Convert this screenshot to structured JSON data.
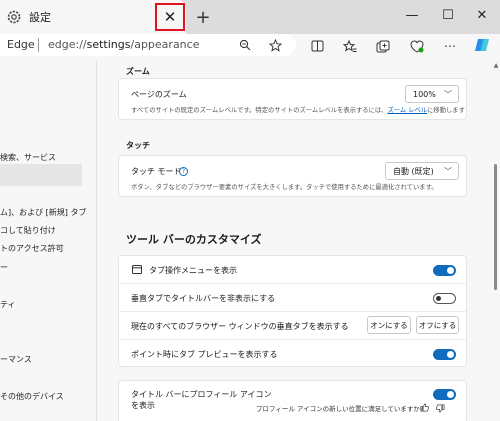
{
  "window": {
    "tab_title": "設定",
    "close_tab_symbol": "✕",
    "new_tab_symbol": "+",
    "minimize_symbol": "—",
    "maximize_symbol": "☐",
    "close_symbol": "✕"
  },
  "address_bar": {
    "site_label": "Edge",
    "url_prefix": "edge://",
    "url_bold": "settings",
    "url_suffix": "/appearance"
  },
  "sidebar": {
    "items": [
      "検索、サービス",
      "",
      "ム]、および [新規] タブ",
      "コして貼り付け",
      "トのアクセス許可",
      "ー",
      "ティ",
      "ーマンス",
      "その他のデバイス"
    ]
  },
  "zoom": {
    "section_title": "ズーム",
    "label": "ページのズーム",
    "description_prefix": "すべてのサイトの既定のズームレベルです。特定のサイトのズームレベルを表示するには、",
    "description_link": "ズーム レベル",
    "description_suffix": "に移動します",
    "value": "100%"
  },
  "touch": {
    "section_title": "タッチ",
    "label": "タッチ モード",
    "description": "ボタン、タブなどのブラウザー要素のサイズを大きくします。タッチで使用するために最適化されています。",
    "value": "自動 (既定)"
  },
  "toolbar": {
    "title": "ツール バーのカスタマイズ",
    "rows": [
      {
        "label": "タブ操作メニューを表示",
        "state": "on"
      },
      {
        "label": "垂直タブでタイトルバーを非表示にする",
        "state": "off"
      },
      {
        "label": "現在のすべてのブラウザー ウィンドウの垂直タブを表示する",
        "state": "buttons"
      },
      {
        "label": "ポイント時にタブ プレビューを表示する",
        "state": "on"
      }
    ],
    "button_on": "オンにする",
    "button_off": "オフにする"
  },
  "profile_row": {
    "label_line1": "タイトル バーにプロフィール アイコン",
    "label_line2": "を表示",
    "state": "on",
    "feedback": "プロフィール アイコンの新しい位置に満足していますか?"
  },
  "colors": {
    "accent": "#0f6cbd",
    "highlight": "#e0141e"
  }
}
